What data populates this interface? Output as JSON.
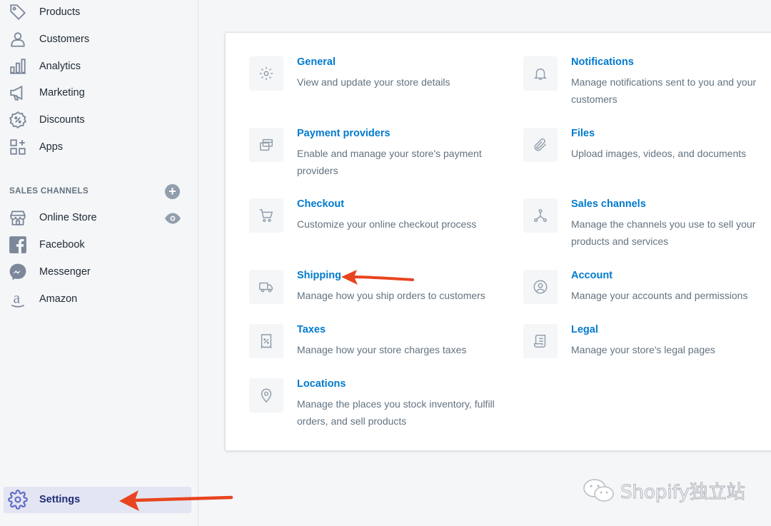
{
  "sidebar": {
    "items": [
      {
        "label": "Products",
        "icon": "tag-icon"
      },
      {
        "label": "Customers",
        "icon": "person-icon"
      },
      {
        "label": "Analytics",
        "icon": "bar-chart-icon"
      },
      {
        "label": "Marketing",
        "icon": "megaphone-icon"
      },
      {
        "label": "Discounts",
        "icon": "discount-icon"
      },
      {
        "label": "Apps",
        "icon": "apps-icon"
      }
    ],
    "sales_channels_label": "SALES CHANNELS",
    "channels": [
      {
        "label": "Online Store",
        "icon": "store-icon"
      },
      {
        "label": "Facebook",
        "icon": "facebook-icon"
      },
      {
        "label": "Messenger",
        "icon": "messenger-icon"
      },
      {
        "label": "Amazon",
        "icon": "amazon-icon"
      }
    ],
    "settings_label": "Settings"
  },
  "settings": [
    {
      "title": "General",
      "desc": "View and update your store details",
      "icon": "gear-icon"
    },
    {
      "title": "Notifications",
      "desc": "Manage notifications sent to you and your customers",
      "icon": "bell-icon"
    },
    {
      "title": "Payment providers",
      "desc": "Enable and manage your store's payment providers",
      "icon": "credit-card-icon"
    },
    {
      "title": "Files",
      "desc": "Upload images, videos, and documents",
      "icon": "paperclip-icon"
    },
    {
      "title": "Checkout",
      "desc": "Customize your online checkout process",
      "icon": "cart-icon"
    },
    {
      "title": "Sales channels",
      "desc": "Manage the channels you use to sell your products and services",
      "icon": "channels-icon"
    },
    {
      "title": "Shipping",
      "desc": "Manage how you ship orders to customers",
      "icon": "truck-icon"
    },
    {
      "title": "Account",
      "desc": "Manage your accounts and permissions",
      "icon": "account-icon"
    },
    {
      "title": "Taxes",
      "desc": "Manage how your store charges taxes",
      "icon": "receipt-icon"
    },
    {
      "title": "Legal",
      "desc": "Manage your store's legal pages",
      "icon": "legal-icon"
    },
    {
      "title": "Locations",
      "desc": "Manage the places you stock inventory, fulfill orders, and sell products",
      "icon": "location-pin-icon"
    }
  ],
  "watermark": "Shopify独立站",
  "colors": {
    "link": "#007ace",
    "annotation_arrow": "#e8441f",
    "active_nav": "#202e78"
  }
}
